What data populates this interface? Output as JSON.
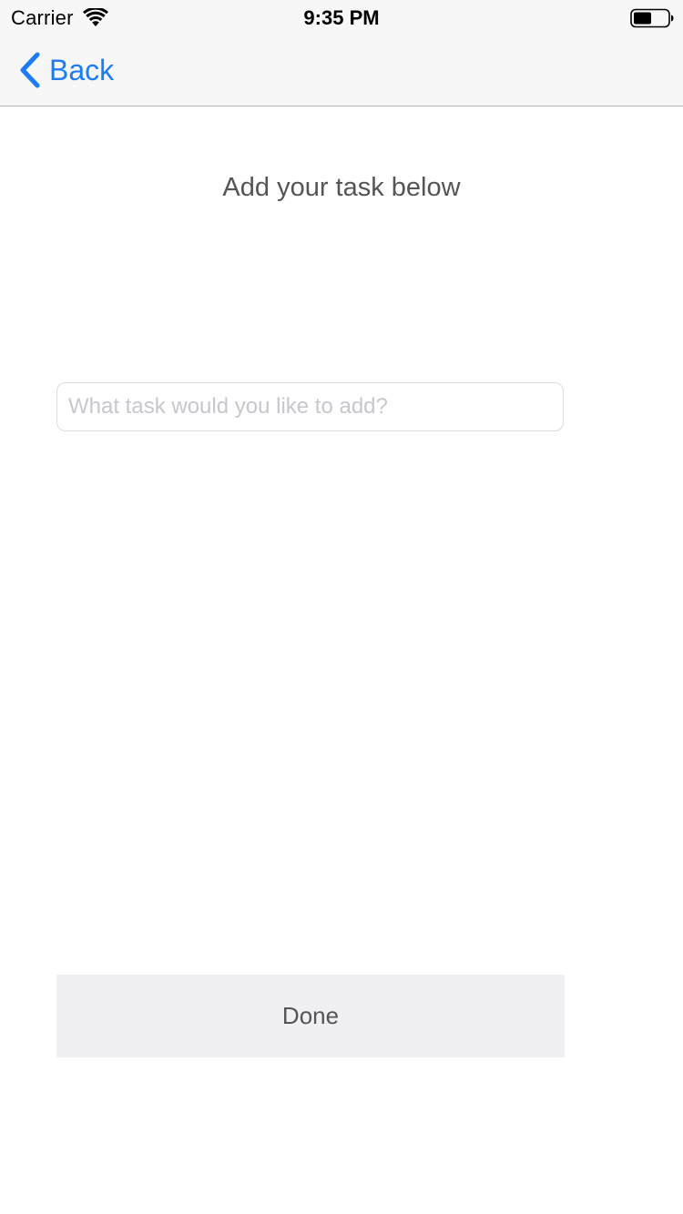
{
  "status_bar": {
    "carrier": "Carrier",
    "time": "9:35 PM",
    "wifi_icon": "wifi-icon",
    "battery_icon": "battery-icon"
  },
  "nav": {
    "back_label": "Back",
    "back_icon": "chevron-left-icon",
    "accent_color": "#1b7cf6"
  },
  "main": {
    "heading": "Add your task below",
    "task_input": {
      "value": "",
      "placeholder": "What task would you like to add?"
    },
    "done_label": "Done"
  },
  "colors": {
    "nav_background": "#f7f7f7",
    "button_background": "#efeff4",
    "text_gray": "#555555",
    "placeholder_gray": "#c7c7cd"
  }
}
